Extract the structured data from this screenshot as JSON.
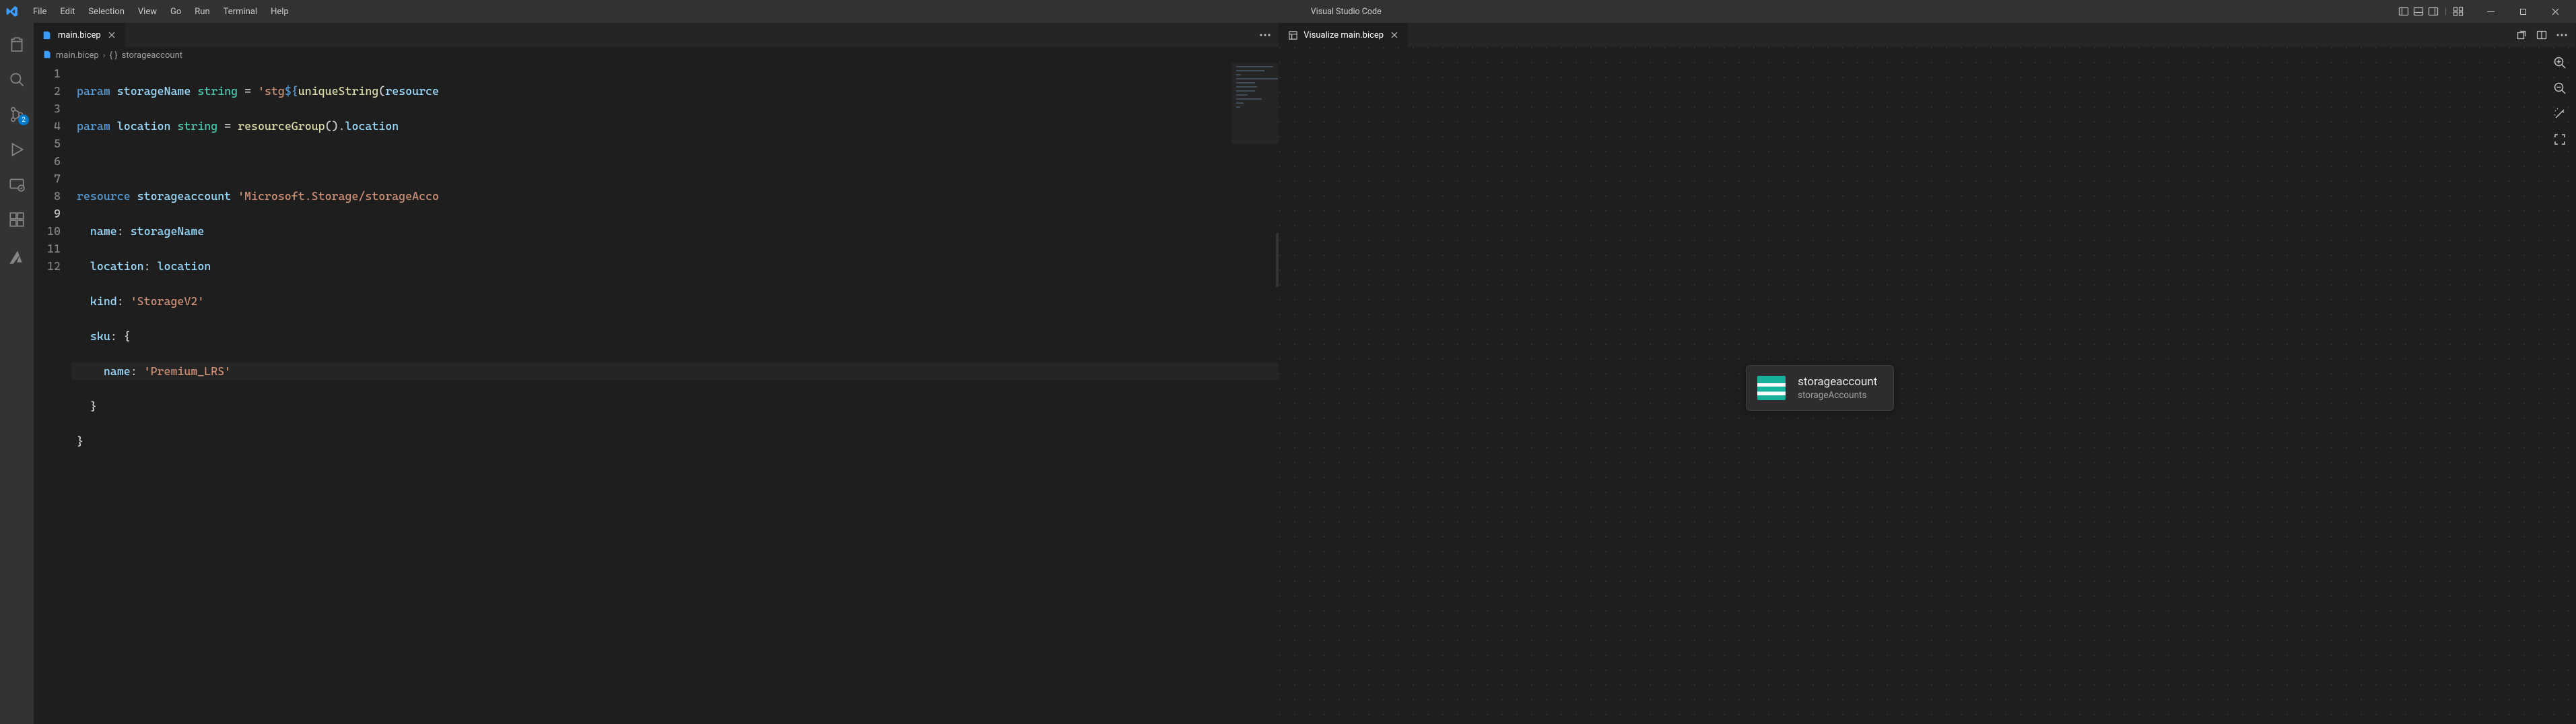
{
  "app_title": "Visual Studio Code",
  "menu": [
    "File",
    "Edit",
    "Selection",
    "View",
    "Go",
    "Run",
    "Terminal",
    "Help"
  ],
  "activity_bar": {
    "scm_badge": "2"
  },
  "left_pane": {
    "tab_label": "main.bicep",
    "breadcrumb": {
      "file": "main.bicep",
      "symbol": "storageaccount"
    },
    "line_numbers": [
      "1",
      "2",
      "3",
      "4",
      "5",
      "6",
      "7",
      "8",
      "9",
      "10",
      "11",
      "12"
    ],
    "current_line_index": 8,
    "code": {
      "l1": {
        "kw": "param",
        "id": "storageName",
        "type": "string",
        "eq": "=",
        "str_a": "'stg",
        "tmpl_open": "${",
        "fn": "uniqueString",
        "paren_open": "(",
        "id2": "resource"
      },
      "l2": {
        "kw": "param",
        "id": "location",
        "type": "string",
        "eq": "=",
        "fn": "resourceGroup",
        "parens": "()",
        "dot": ".",
        "prop": "location"
      },
      "l4": {
        "kw": "resource",
        "id": "storageaccount",
        "str": "'Microsoft.Storage/storageAcco"
      },
      "l5": {
        "prop": "name",
        "colon": ":",
        "val": "storageName"
      },
      "l6": {
        "prop": "location",
        "colon": ":",
        "val": "location"
      },
      "l7": {
        "prop": "kind",
        "colon": ":",
        "str": "'StorageV2'"
      },
      "l8": {
        "prop": "sku",
        "colon": ":",
        "brace": "{"
      },
      "l9": {
        "prop": "name",
        "colon": ":",
        "str": "'Premium_LRS'"
      },
      "l10": {
        "brace": "}"
      },
      "l11": {
        "brace": "}"
      }
    }
  },
  "right_pane": {
    "tab_prefix_icon": "preview",
    "tab_label": "Visualize main.bicep",
    "node": {
      "title": "storageaccount",
      "subtitle": "storageAccounts"
    }
  }
}
